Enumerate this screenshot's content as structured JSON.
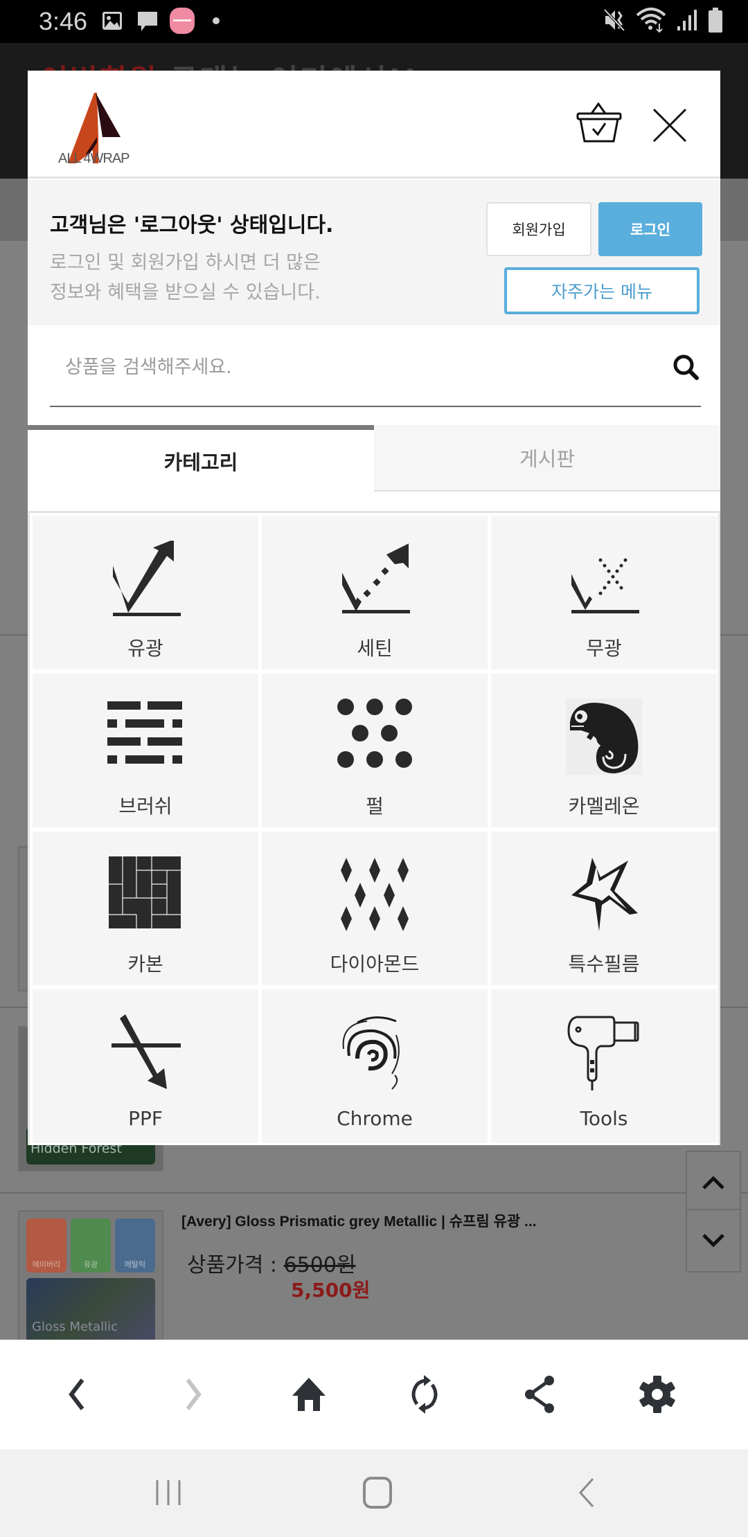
{
  "status_bar": {
    "time": "3:46",
    "left_icons": [
      "gallery-icon",
      "message-icon",
      "app-badge-icon",
      "dot-icon"
    ],
    "right_icons": [
      "vibrate-icon",
      "wifi-icon",
      "signal-icon",
      "battery-icon"
    ]
  },
  "background_page": {
    "banner_text_red": "이번회원",
    "banner_text_rest": " 구매는 여기에서!!",
    "product_thumb_caption": "Hidden Forest",
    "product_title": "[Avery] Gloss Prismatic grey Metallic | 슈프림 유광 ...",
    "price_label": "상품가격 : ",
    "price_original": "6500원",
    "price_sale": "5,500원",
    "thumb_badges": [
      "에이버리",
      "유광",
      "메탈릭"
    ],
    "thumb_caption_2": "Gloss Metallic"
  },
  "modal": {
    "logo_text": "ALL 4WRAP",
    "status_title": "고객님은 '로그아웃' 상태입니다.",
    "status_desc": "로그인 및 회원가입 하시면 더 많은\n정보와 혜택을 받으실 수 있습니다.",
    "join_label": "회원가입",
    "login_label": "로그인",
    "frequent_menu_label": "자주가는 메뉴",
    "search": {
      "placeholder": "상품을 검색해주세요.",
      "value": ""
    },
    "tabs": [
      {
        "label": "카테고리",
        "active": true
      },
      {
        "label": "게시판",
        "active": false
      }
    ],
    "categories": [
      {
        "label": "유광",
        "icon": "gloss-icon"
      },
      {
        "label": "세틴",
        "icon": "satin-icon"
      },
      {
        "label": "무광",
        "icon": "matte-icon"
      },
      {
        "label": "브러쉬",
        "icon": "brushed-icon"
      },
      {
        "label": "펄",
        "icon": "pearl-icon"
      },
      {
        "label": "카멜레온",
        "icon": "chameleon-icon"
      },
      {
        "label": "카본",
        "icon": "carbon-icon"
      },
      {
        "label": "다이아몬드",
        "icon": "diamond-icon"
      },
      {
        "label": "특수필름",
        "icon": "special-film-icon"
      },
      {
        "label": "PPF",
        "icon": "ppf-icon"
      },
      {
        "label": "Chrome",
        "icon": "chrome-icon"
      },
      {
        "label": "Tools",
        "icon": "tools-icon"
      }
    ]
  },
  "browser_bar": {
    "buttons": [
      "back-icon",
      "forward-icon",
      "home-icon",
      "refresh-icon",
      "share-icon",
      "settings-icon"
    ]
  },
  "nav_bar": {
    "buttons": [
      "recent-apps-icon",
      "home-icon",
      "back-icon"
    ]
  },
  "colors": {
    "accent_blue": "#5aaedc",
    "sale_red": "#8b1a1a",
    "logo_orange": "#c8461c",
    "logo_dark": "#2a0c12"
  }
}
